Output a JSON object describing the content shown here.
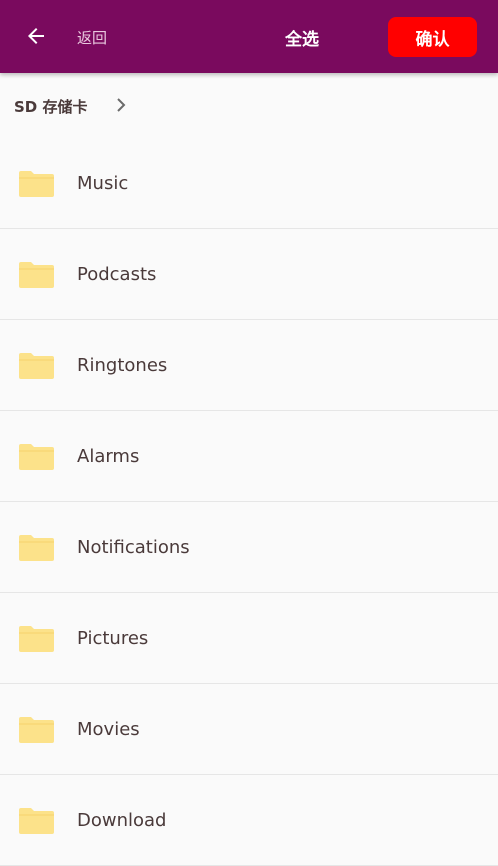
{
  "topbar": {
    "back_label": "返回",
    "select_all_label": "全选",
    "confirm_label": "确认",
    "bar_color": "#7a0a5e",
    "confirm_color": "#ff0000"
  },
  "breadcrumb": {
    "label": "SD 存储卡"
  },
  "folders": [
    {
      "label": "Music"
    },
    {
      "label": "Podcasts"
    },
    {
      "label": "Ringtones"
    },
    {
      "label": "Alarms"
    },
    {
      "label": "Notifications"
    },
    {
      "label": "Pictures"
    },
    {
      "label": "Movies"
    },
    {
      "label": "Download"
    }
  ],
  "icons": {
    "back": "arrow-left-icon",
    "chevron": "chevron-right-icon",
    "folder": "folder-icon"
  }
}
